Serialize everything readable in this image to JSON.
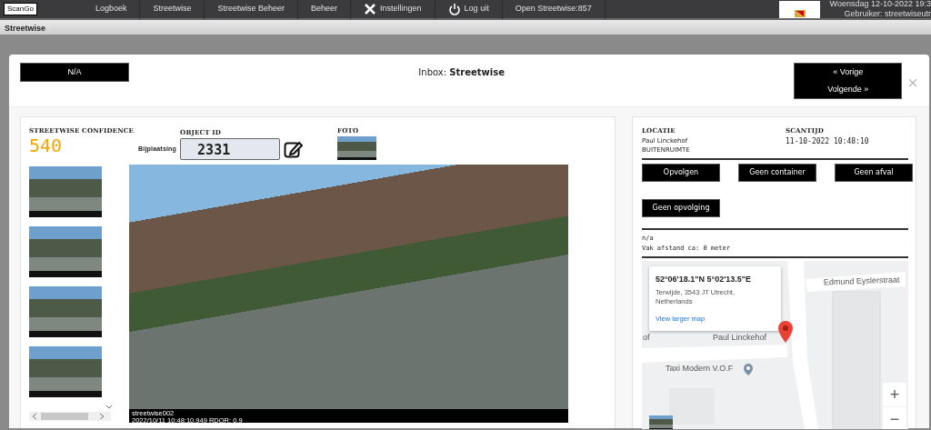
{
  "navbar": {
    "logo": "ScanGo",
    "items": [
      {
        "label": "Logboek"
      },
      {
        "label": "Streetwise"
      },
      {
        "label": "Streetwise Beheer"
      },
      {
        "label": "Beheer"
      },
      {
        "label": "Instellingen"
      },
      {
        "label": "Log uit"
      },
      {
        "label": "Open Streetwise:857"
      }
    ],
    "date": "Woensdag 12-10-2022 19:3",
    "user": "Gebruiker: streetwiseutr"
  },
  "page_title": "Streetwise",
  "modal": {
    "status_button": "N/A",
    "inbox_label": "Inbox: ",
    "inbox_name": "Streetwise",
    "prev_button": "« Vorige",
    "next_button": "Volgende »",
    "close": "×"
  },
  "detail": {
    "confidence_label": "STREETWISE CONFIDENCE",
    "confidence": "540",
    "object_id_label": "OBJECT ID",
    "object_type": "Bijplaatsing",
    "object_id": "2331",
    "foto_label": "FOTO",
    "thumbnails": [
      {
        "selected": false
      },
      {
        "selected": false
      },
      {
        "selected": false
      },
      {
        "selected": false
      }
    ],
    "photo_caption": [
      "streetwise002",
      "2022/10/11 10:48:10.949 RDOR: 0.9"
    ]
  },
  "side": {
    "location_label": "LOCATIE",
    "location": [
      "Paul Linckehof",
      "BUITENRUIMTE"
    ],
    "scantime_label": "SCANTIJD",
    "scantime": "11-10-2022 10:48:10",
    "actions": [
      "Opvolgen",
      "Geen container",
      "Geen afval",
      "Geen opvolging"
    ],
    "notes": [
      "n/a",
      "Vak afstand ca: 0 meter"
    ],
    "map": {
      "coords": "52°06'18.1\"N 5°02'13.5\"E",
      "address": "Terwijde, 3543 JT Utrecht, Netherlands",
      "link": "View larger map",
      "labels": [
        {
          "kind": "street",
          "text": "Edmund Eyslerstraat"
        },
        {
          "kind": "street",
          "text": "of"
        },
        {
          "kind": "street",
          "text": "Paul Linckehof"
        },
        {
          "kind": "poi",
          "text": "Taxi Modern V.O.F"
        }
      ],
      "zoom_in": "+",
      "zoom_out": "−"
    }
  }
}
